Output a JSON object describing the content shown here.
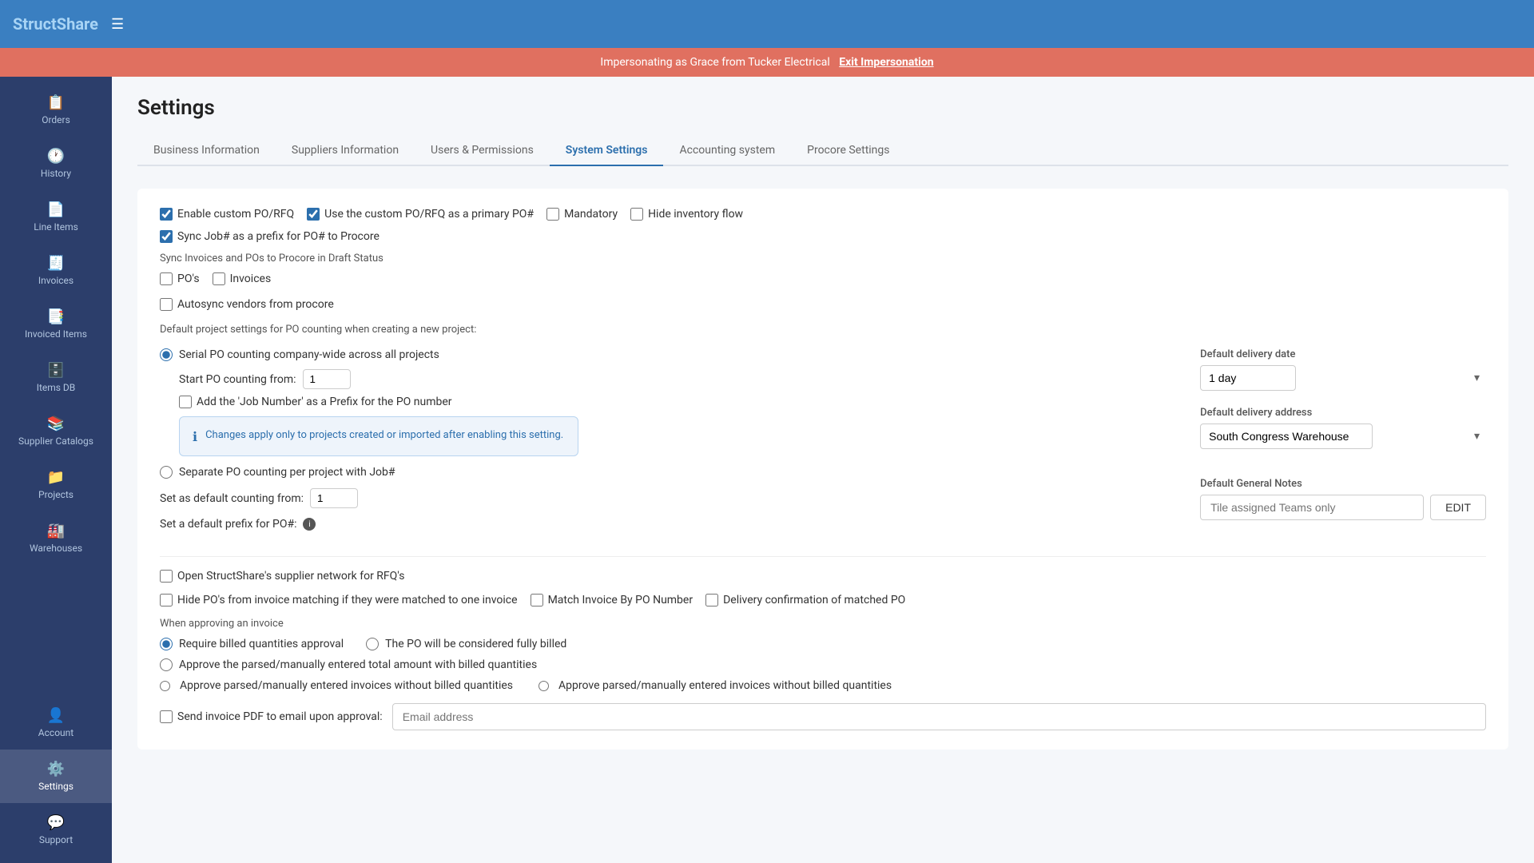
{
  "app": {
    "logo_main": "Struct",
    "logo_accent": "Share"
  },
  "impersonation": {
    "text": "Impersonating as Grace from Tucker Electrical",
    "exit_label": "Exit Impersonation"
  },
  "sidebar": {
    "items": [
      {
        "id": "orders",
        "label": "Orders",
        "icon": "📋"
      },
      {
        "id": "history",
        "label": "History",
        "icon": "🕐"
      },
      {
        "id": "line-items",
        "label": "Line Items",
        "icon": "📄"
      },
      {
        "id": "invoices",
        "label": "Invoices",
        "icon": "🧾"
      },
      {
        "id": "invoiced-items",
        "label": "Invoiced Items",
        "icon": "📑"
      },
      {
        "id": "items-db",
        "label": "Items DB",
        "icon": "🗄️"
      },
      {
        "id": "supplier-catalogs",
        "label": "Supplier Catalogs",
        "icon": "📚"
      },
      {
        "id": "projects",
        "label": "Projects",
        "icon": "📁"
      },
      {
        "id": "warehouses",
        "label": "Warehouses",
        "icon": "🏭"
      },
      {
        "id": "account",
        "label": "Account",
        "icon": "👤"
      },
      {
        "id": "settings",
        "label": "Settings",
        "icon": "⚙️",
        "active": true
      },
      {
        "id": "support",
        "label": "Support",
        "icon": "💬"
      }
    ]
  },
  "page": {
    "title": "Settings"
  },
  "tabs": [
    {
      "id": "business-info",
      "label": "Business Information",
      "active": false
    },
    {
      "id": "suppliers-info",
      "label": "Suppliers Information",
      "active": false
    },
    {
      "id": "users-permissions",
      "label": "Users & Permissions",
      "active": false
    },
    {
      "id": "system-settings",
      "label": "System Settings",
      "active": true
    },
    {
      "id": "accounting-system",
      "label": "Accounting system",
      "active": false
    },
    {
      "id": "procore-settings",
      "label": "Procore Settings",
      "active": false
    }
  ],
  "settings": {
    "enable_custom_po_rfq": "Enable custom PO/RFQ",
    "use_custom_primary": "Use the custom PO/RFQ as a primary PO#",
    "mandatory": "Mandatory",
    "hide_inventory_flow": "Hide inventory flow",
    "sync_job_prefix": "Sync Job# as a prefix for PO# to Procore",
    "sync_invoices_pos_label": "Sync Invoices and POs to Procore in Draft Status",
    "pos_label": "PO's",
    "invoices_label": "Invoices",
    "autosync_vendors": "Autosync vendors from procore",
    "default_project_settings_label": "Default project settings for PO counting when creating a new project:",
    "serial_po_counting": "Serial PO counting company-wide across all projects",
    "start_po_counting_label": "Start PO counting from:",
    "start_po_value": "1",
    "add_job_number_prefix": "Add the 'Job Number' as a Prefix for the PO number",
    "info_box_text": "Changes apply only to projects created or imported after enabling this setting.",
    "separate_po_counting": "Separate PO counting per project with Job#",
    "set_default_counting_label": "Set as default counting from:",
    "set_default_counting_value": "1",
    "set_default_prefix_label": "Set a default prefix for PO#:",
    "open_supplier_network": "Open StructShare's supplier network for RFQ's",
    "hide_pos_invoice_matching": "Hide PO's from invoice matching if they were matched to one invoice",
    "match_invoice_by_po": "Match Invoice By PO Number",
    "delivery_confirmation": "Delivery confirmation of matched PO",
    "when_approving_label": "When approving an invoice",
    "require_billed_quantities": "Require billed quantities approval",
    "po_fully_billed": "The PO will be considered fully billed",
    "approve_parsed_billed": "Approve the parsed/manually entered total amount with billed quantities",
    "approve_parsed_without_billed": "Approve parsed/manually entered invoices without billed quantities",
    "send_invoice_pdf_label": "Send invoice PDF to email upon approval:",
    "email_placeholder": "Email address",
    "default_delivery_date_label": "Default delivery date",
    "default_delivery_date_value": "1 day",
    "default_delivery_address_label": "Default delivery address",
    "default_delivery_address_value": "South Congress Warehouse",
    "default_general_notes_label": "Default General Notes",
    "notes_placeholder": "Tile assigned Teams only",
    "edit_label": "EDIT"
  }
}
